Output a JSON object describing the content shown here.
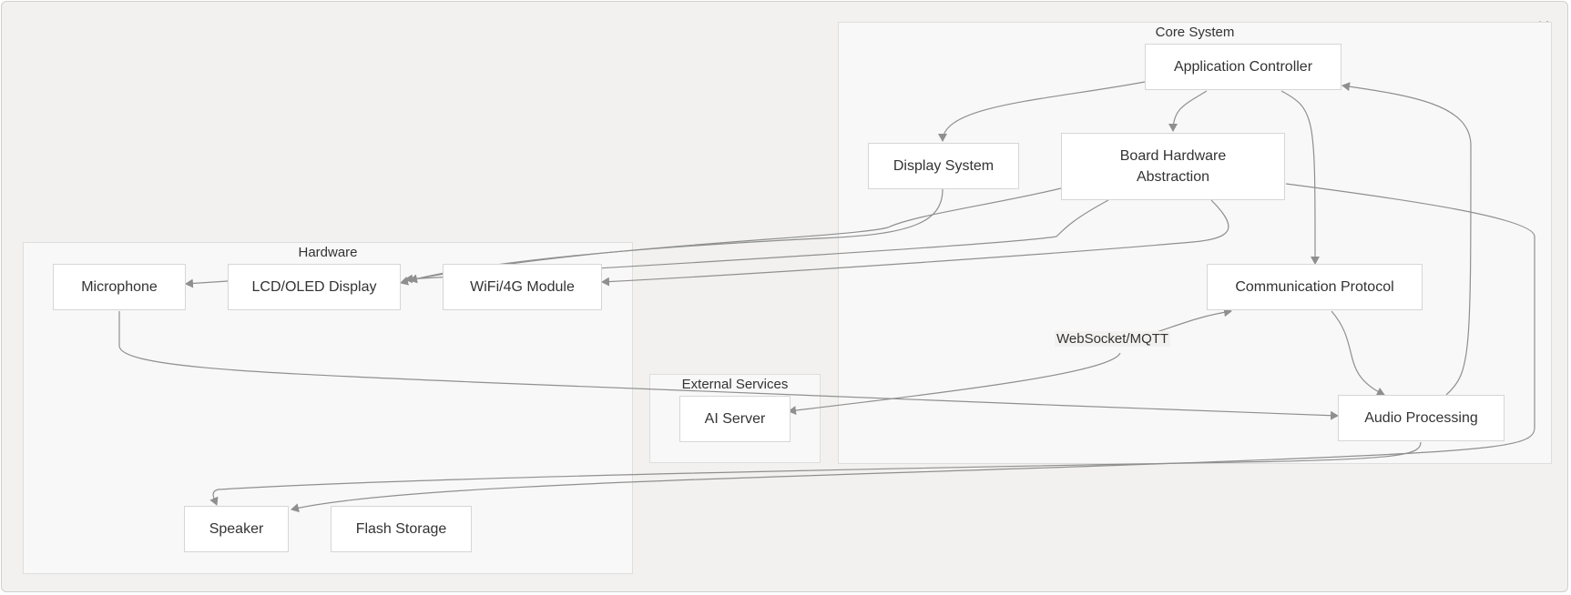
{
  "window": {
    "close_icon": "close-icon",
    "close_glyph": "✕"
  },
  "clusters": {
    "core": "Core System",
    "hardware": "Hardware",
    "external": "External Services"
  },
  "nodes": {
    "app_controller": "Application Controller",
    "display_system": "Display System",
    "board_hal_line1": "Board Hardware",
    "board_hal_line2": "Abstraction",
    "comm_protocol": "Communication Protocol",
    "audio_processing": "Audio Processing",
    "microphone": "Microphone",
    "lcd_display": "LCD/OLED Display",
    "wifi_module": "WiFi/4G Module",
    "speaker": "Speaker",
    "flash_storage": "Flash Storage",
    "ai_server": "AI Server"
  },
  "edges": {
    "websocket_label": "WebSocket/MQTT"
  },
  "colors": {
    "background": "#f2f1f0",
    "cluster_fill": "#f8f8f8",
    "node_fill": "#ffffff",
    "edge": "#8f8f8f"
  }
}
